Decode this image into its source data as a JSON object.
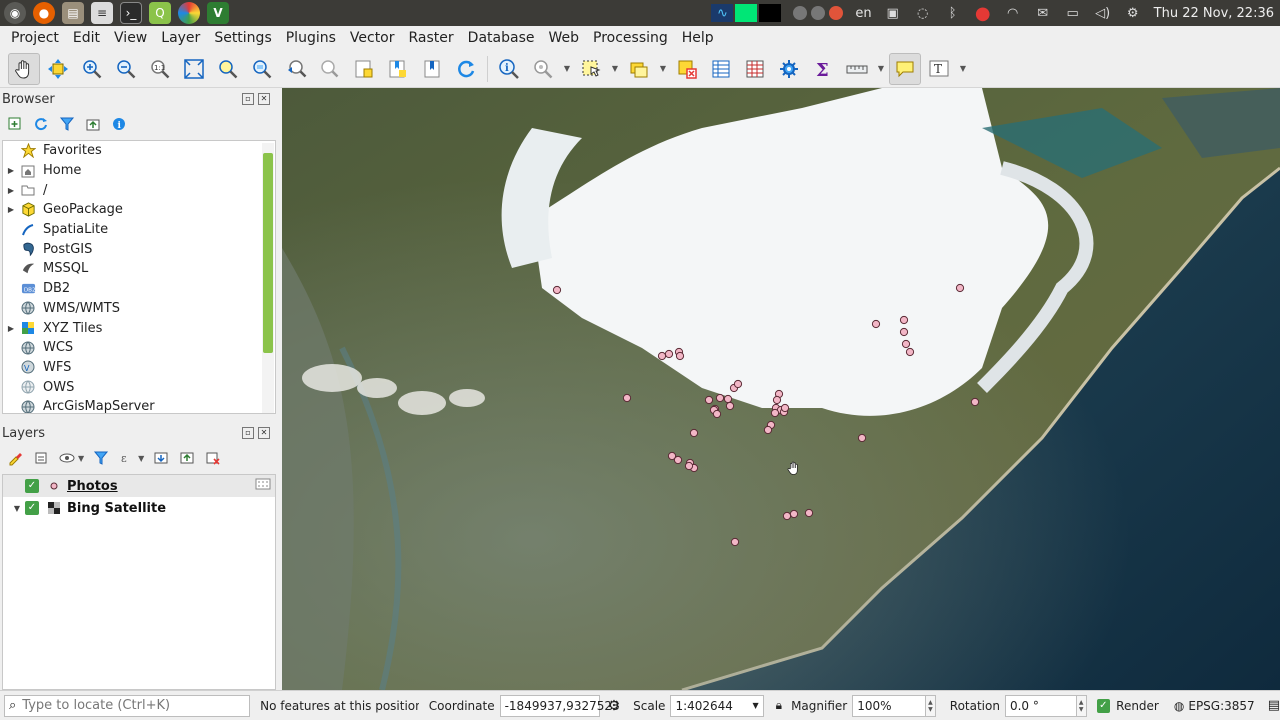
{
  "os": {
    "keyboard_layout": "en",
    "clock": "Thu 22 Nov, 22:36"
  },
  "menu": [
    "Project",
    "Edit",
    "View",
    "Layer",
    "Settings",
    "Plugins",
    "Vector",
    "Raster",
    "Database",
    "Web",
    "Processing",
    "Help"
  ],
  "browser": {
    "title": "Browser",
    "items": [
      {
        "label": "Favorites",
        "icon": "star-icon",
        "expandable": false
      },
      {
        "label": "Home",
        "icon": "home-folder-icon",
        "expandable": true
      },
      {
        "label": "/",
        "icon": "folder-icon",
        "expandable": true
      },
      {
        "label": "GeoPackage",
        "icon": "geopackage-icon",
        "expandable": true
      },
      {
        "label": "SpatiaLite",
        "icon": "spatialite-icon",
        "expandable": false
      },
      {
        "label": "PostGIS",
        "icon": "postgis-icon",
        "expandable": false
      },
      {
        "label": "MSSQL",
        "icon": "mssql-icon",
        "expandable": false
      },
      {
        "label": "DB2",
        "icon": "db2-icon",
        "expandable": false
      },
      {
        "label": "WMS/WMTS",
        "icon": "wms-globe-icon",
        "expandable": false
      },
      {
        "label": "XYZ Tiles",
        "icon": "xyz-tiles-icon",
        "expandable": true
      },
      {
        "label": "WCS",
        "icon": "wcs-globe-icon",
        "expandable": false
      },
      {
        "label": "WFS",
        "icon": "wfs-globe-icon",
        "expandable": false
      },
      {
        "label": "OWS",
        "icon": "ows-globe-icon",
        "expandable": false
      },
      {
        "label": "ArcGisMapServer",
        "icon": "arcgis-globe-icon",
        "expandable": false
      }
    ]
  },
  "layers": {
    "title": "Layers",
    "items": [
      {
        "label": "Photos",
        "checked": true,
        "selected": true,
        "icon": "point-layer-icon"
      },
      {
        "label": "Bing Satellite",
        "checked": true,
        "selected": false,
        "icon": "raster-layer-icon"
      }
    ]
  },
  "status": {
    "locate_placeholder": "Type to locate (Ctrl+K)",
    "message": "No features at this position four",
    "coordinate_label": "Coordinate",
    "coordinate_value": "-1849937,9327523",
    "scale_label": "Scale",
    "scale_value": "1:402644",
    "magnifier_label": "Magnifier",
    "magnifier_value": "100%",
    "rotation_label": "Rotation",
    "rotation_value": "0.0 °",
    "render_label": "Render",
    "crs": "EPSG:3857"
  },
  "colors": {
    "point_fill": "#f2b6c6",
    "point_stroke": "#5a2a35",
    "accent_green": "#43a047"
  }
}
